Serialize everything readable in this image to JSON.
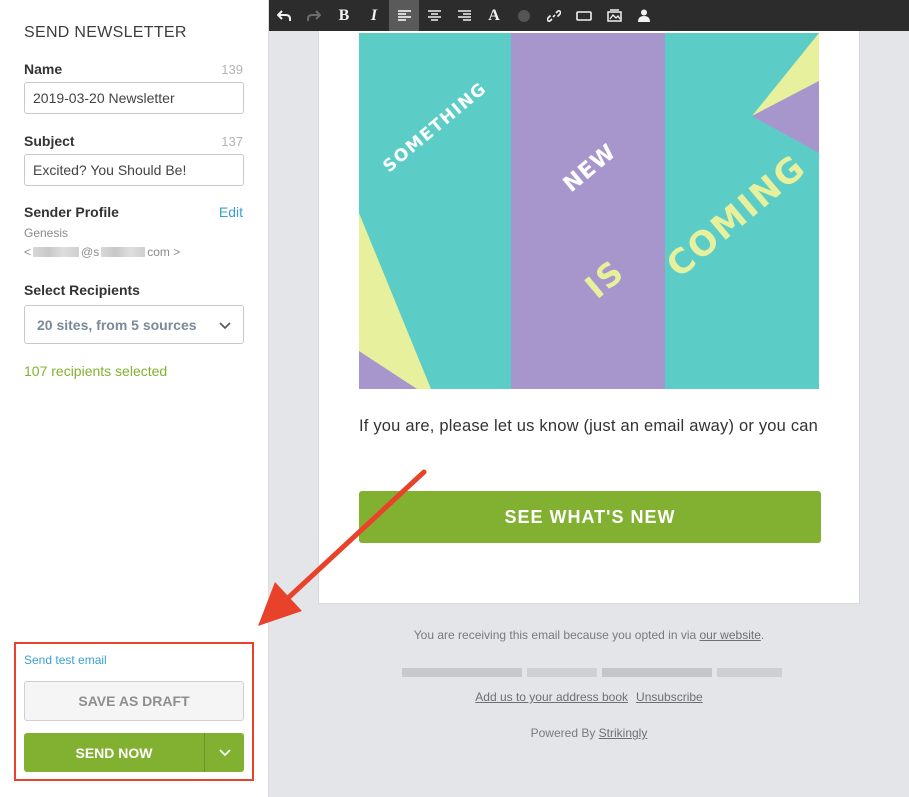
{
  "sidebar": {
    "title": "SEND NEWSLETTER",
    "name": {
      "label": "Name",
      "count": "139",
      "value": "2019-03-20 Newsletter"
    },
    "subject": {
      "label": "Subject",
      "count": "137",
      "value": "Excited? You Should Be!"
    },
    "sender": {
      "label": "Sender Profile",
      "edit": "Edit",
      "name": "Genesis",
      "email_open": "<",
      "email_at": "@s",
      "email_domain_end": "com >"
    },
    "recipients": {
      "label": "Select Recipients",
      "selected": "20 sites, from 5 sources",
      "count_text": "107 recipients selected"
    },
    "test_email": "Send test email",
    "save_draft": "SAVE AS DRAFT",
    "send_now": "SEND NOW"
  },
  "toolbar": {
    "icons": [
      "undo-icon",
      "redo-icon",
      "bold-icon",
      "italic-icon",
      "align-left-icon",
      "align-center-icon",
      "align-right-icon",
      "font-color-icon",
      "circle-icon",
      "link-icon",
      "button-icon",
      "image-icon",
      "user-icon"
    ],
    "bold": "B",
    "italic": "I",
    "font": "A"
  },
  "email": {
    "hero": {
      "word1": "SOMETHING",
      "word2": "NEW",
      "word3": "IS",
      "word4": "COMING"
    },
    "body": "If you are, please let us know (just an email away) or you can",
    "cta": "SEE WHAT'S NEW",
    "footer_prefix": "You are receiving this email because you opted in via ",
    "footer_link": "our website",
    "footer_suffix": ".",
    "address_book": "Add us to your address book",
    "unsubscribe": "Unsubscribe",
    "powered_prefix": "Powered By ",
    "powered_link": "Strikingly"
  },
  "colors": {
    "accent_green": "#82b131",
    "teal": "#5bcdc6",
    "lavender": "#a796cc",
    "yellow": "#e7f09c",
    "annotation_red": "#e8432a"
  }
}
